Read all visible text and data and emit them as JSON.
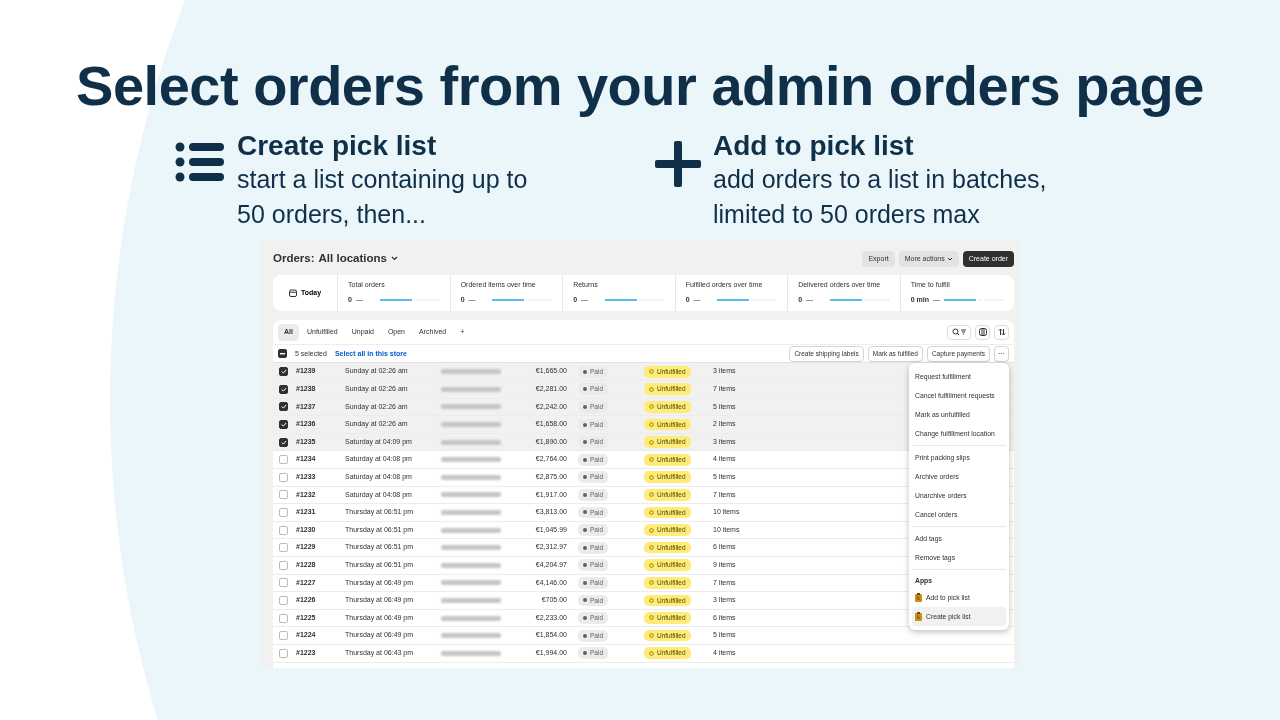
{
  "headline": "Select orders from your admin orders page",
  "features": [
    {
      "kind": "list",
      "title": "Create pick list",
      "text": "start a list containing up to 50 orders, then..."
    },
    {
      "kind": "plus",
      "title": "Add to pick list",
      "text": "add orders to a list in batches, limited to 50 orders max"
    }
  ],
  "screen": {
    "page_title": "Orders:",
    "location": "All locations",
    "header_buttons": [
      {
        "label": "Export",
        "kind": "plain"
      },
      {
        "label": "More actions",
        "kind": "dropdown"
      },
      {
        "label": "Create order",
        "kind": "primary"
      }
    ],
    "date_filter": "Today",
    "stats": [
      {
        "label": "Total orders",
        "value": "0",
        "delta": "—"
      },
      {
        "label": "Ordered items over time",
        "value": "0",
        "delta": "—"
      },
      {
        "label": "Returns",
        "value": "0",
        "delta": "—"
      },
      {
        "label": "Fulfilled orders over time",
        "value": "0",
        "delta": "—"
      },
      {
        "label": "Delivered orders over time",
        "value": "0",
        "delta": "—"
      },
      {
        "label": "Time to fulfill",
        "value": "0 min",
        "delta": "—"
      }
    ],
    "tabs": [
      {
        "label": "All",
        "selected": true
      },
      {
        "label": "Unfulfilled",
        "selected": false
      },
      {
        "label": "Unpaid",
        "selected": false
      },
      {
        "label": "Open",
        "selected": false
      },
      {
        "label": "Archived",
        "selected": false
      },
      {
        "label": "+",
        "selected": false
      }
    ],
    "bulk": {
      "indeterminate": true,
      "count": "5 selected",
      "select_all": "Select all in this store",
      "actions": [
        "Create shipping labels",
        "Mark as fulfilled",
        "Capture payments"
      ],
      "more": "⋯"
    },
    "rows": [
      {
        "order": "#1239",
        "date": "Sunday at 02:26 am",
        "total": "€1,665.00",
        "payment": "Paid",
        "fulfillment": "Unfulfilled",
        "items": "3 items",
        "checked": true
      },
      {
        "order": "#1238",
        "date": "Sunday at 02:26 am",
        "total": "€2,281.00",
        "payment": "Paid",
        "fulfillment": "Unfulfilled",
        "items": "7 items",
        "checked": true
      },
      {
        "order": "#1237",
        "date": "Sunday at 02:26 am",
        "total": "€2,242.00",
        "payment": "Paid",
        "fulfillment": "Unfulfilled",
        "items": "5 items",
        "checked": true
      },
      {
        "order": "#1236",
        "date": "Sunday at 02:26 am",
        "total": "€1,658.00",
        "payment": "Paid",
        "fulfillment": "Unfulfilled",
        "items": "2 items",
        "checked": true
      },
      {
        "order": "#1235",
        "date": "Saturday at 04:09 pm",
        "total": "€1,890.00",
        "payment": "Paid",
        "fulfillment": "Unfulfilled",
        "items": "3 items",
        "checked": true
      },
      {
        "order": "#1234",
        "date": "Saturday at 04:08 pm",
        "total": "€2,764.00",
        "payment": "Paid",
        "fulfillment": "Unfulfilled",
        "items": "4 items",
        "checked": false
      },
      {
        "order": "#1233",
        "date": "Saturday at 04:08 pm",
        "total": "€2,875.00",
        "payment": "Paid",
        "fulfillment": "Unfulfilled",
        "items": "5 items",
        "checked": false
      },
      {
        "order": "#1232",
        "date": "Saturday at 04:08 pm",
        "total": "€1,917.00",
        "payment": "Paid",
        "fulfillment": "Unfulfilled",
        "items": "7 items",
        "checked": false
      },
      {
        "order": "#1231",
        "date": "Thursday at 06:51 pm",
        "total": "€3,813.00",
        "payment": "Paid",
        "fulfillment": "Unfulfilled",
        "items": "10 items",
        "checked": false
      },
      {
        "order": "#1230",
        "date": "Thursday at 06:51 pm",
        "total": "€1,045.99",
        "payment": "Paid",
        "fulfillment": "Unfulfilled",
        "items": "10 items",
        "checked": false
      },
      {
        "order": "#1229",
        "date": "Thursday at 06:51 pm",
        "total": "€2,312.97",
        "payment": "Paid",
        "fulfillment": "Unfulfilled",
        "items": "6 items",
        "checked": false
      },
      {
        "order": "#1228",
        "date": "Thursday at 06:51 pm",
        "total": "€4,204.97",
        "payment": "Paid",
        "fulfillment": "Unfulfilled",
        "items": "9 items",
        "checked": false
      },
      {
        "order": "#1227",
        "date": "Thursday at 06:49 pm",
        "total": "€4,146.00",
        "payment": "Paid",
        "fulfillment": "Unfulfilled",
        "items": "7 items",
        "checked": false
      },
      {
        "order": "#1226",
        "date": "Thursday at 06:49 pm",
        "total": "€705.00",
        "payment": "Paid",
        "fulfillment": "Unfulfilled",
        "items": "3 items",
        "checked": false
      },
      {
        "order": "#1225",
        "date": "Thursday at 06:49 pm",
        "total": "€2,233.00",
        "payment": "Paid",
        "fulfillment": "Unfulfilled",
        "items": "6 items",
        "checked": false
      },
      {
        "order": "#1224",
        "date": "Thursday at 06:49 pm",
        "total": "€1,854.00",
        "payment": "Paid",
        "fulfillment": "Unfulfilled",
        "items": "5 items",
        "checked": false
      },
      {
        "order": "#1223",
        "date": "Thursday at 06:43 pm",
        "total": "€1,994.00",
        "payment": "Paid",
        "fulfillment": "Unfulfilled",
        "items": "4 items",
        "checked": false
      }
    ],
    "menu": [
      {
        "items": [
          {
            "label": "Request fulfillment",
            "kind": "plain",
            "selected": false
          },
          {
            "label": "Cancel fulfillment requests",
            "kind": "plain",
            "selected": false
          },
          {
            "label": "Mark as unfulfilled",
            "kind": "plain",
            "selected": false
          },
          {
            "label": "Change fulfillment location",
            "kind": "plain",
            "selected": false
          }
        ]
      },
      {
        "items": [
          {
            "label": "Print packing slips",
            "kind": "plain",
            "selected": false
          },
          {
            "label": "Archive orders",
            "kind": "plain",
            "selected": false
          },
          {
            "label": "Unarchive orders",
            "kind": "plain",
            "selected": false
          },
          {
            "label": "Cancel orders",
            "kind": "plain",
            "selected": false
          }
        ]
      },
      {
        "items": [
          {
            "label": "Add tags",
            "kind": "plain",
            "selected": false
          },
          {
            "label": "Remove tags",
            "kind": "plain",
            "selected": false
          }
        ]
      },
      {
        "heading": "Apps",
        "items": [
          {
            "label": "Add to pick list",
            "kind": "app",
            "selected": false
          },
          {
            "label": "Create pick list",
            "kind": "app",
            "selected": true
          }
        ]
      }
    ]
  }
}
